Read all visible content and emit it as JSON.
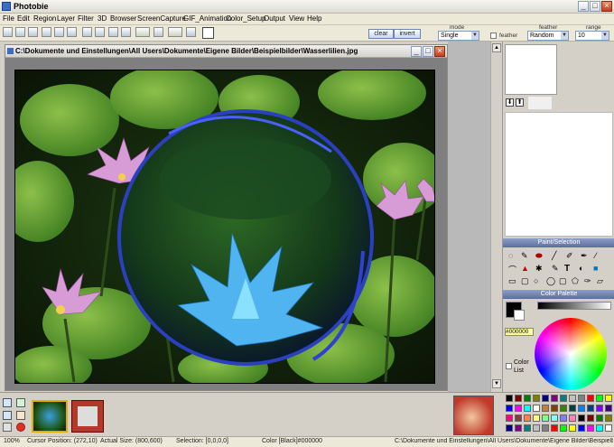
{
  "app": {
    "title": "Photobie"
  },
  "menu": [
    "File",
    "Edit",
    "Region",
    "Layer",
    "Filter",
    "3D",
    "Browser",
    "ScreenCapture",
    "GIF_Animation",
    "Color_Setup",
    "Output",
    "View",
    "Help"
  ],
  "toolbar": {
    "clear_label": "clear",
    "invert_label": "invert",
    "mode_label": "mode",
    "mode_value": "Single",
    "feather_label": "feather",
    "feather_checkbox_label": "feather",
    "feather_value": "Random",
    "range_label": "range",
    "range_value": "10"
  },
  "document": {
    "path": "C:\\Dokumente und Einstellungen\\All Users\\Dokumente\\Eigene Bilder\\Beispielbilder\\Wasserlilien.jpg"
  },
  "panels": {
    "paint_selection": "Paint/Selection",
    "color_palette": "Color Palette",
    "hex_value": "#000000",
    "color_list_label": "Color List"
  },
  "status": {
    "zoom": "100%",
    "cursor": "Cursor Position: (272,10)",
    "actual_size": "Actual Size: (800,600)",
    "selection": "Selection: [0,0,0,0]",
    "color": "Color [Black]#000000",
    "path": "C:\\Dokumente und Einstellungen\\All Users\\Dokumente\\Eigene Bilder\\Beispielbilder\\V"
  },
  "colors": {
    "panel_header": "#6f80ab",
    "photo_bg": "#13210e"
  },
  "palette": [
    "#000000",
    "#800000",
    "#008000",
    "#808000",
    "#000080",
    "#800080",
    "#008080",
    "#c0c0c0",
    "#808080",
    "#ff0000",
    "#00ff00",
    "#ffff00",
    "#0000ff",
    "#ff00ff",
    "#00ffff",
    "#ffffff",
    "#c08040",
    "#804000",
    "#408000",
    "#004040",
    "#0080ff",
    "#004080",
    "#8000ff",
    "#400080",
    "#ff0080",
    "#804040",
    "#ff8040",
    "#ffff80",
    "#80ff80",
    "#80ffff",
    "#8080ff",
    "#ff80c0"
  ]
}
